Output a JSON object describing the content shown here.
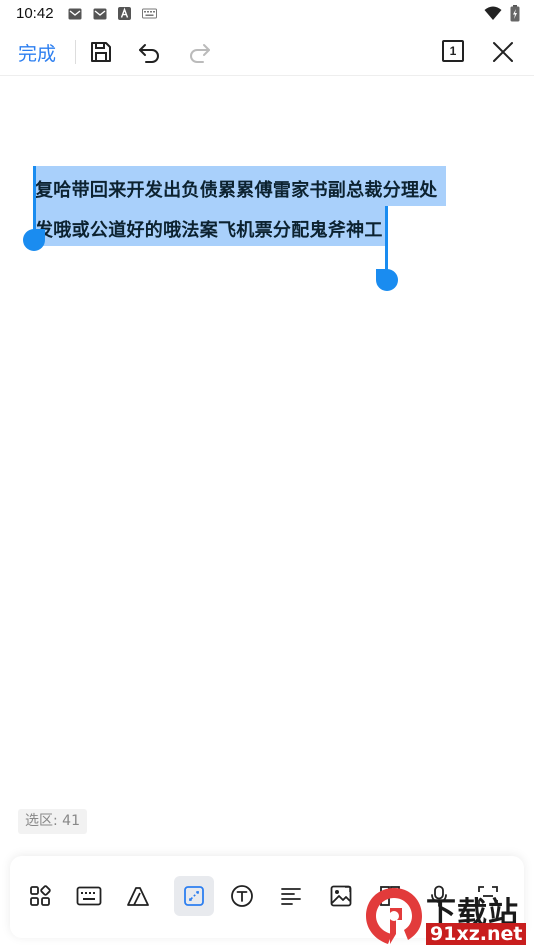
{
  "status_bar": {
    "time": "10:42",
    "icons": [
      "mail-icon",
      "mail-icon",
      "a-app-icon",
      "keyboard-icon"
    ],
    "right_icons": [
      "wifi-icon",
      "battery-charging-icon"
    ]
  },
  "toolbar": {
    "done_label": "完成",
    "icons": [
      "save-icon",
      "undo-icon",
      "redo-icon"
    ],
    "page_number": "1",
    "close_icon": "close-icon"
  },
  "canvas": {
    "selected_lines": [
      "复哈带回来开发出负债累累傅雷家书副总裁分理处",
      "发哦或公道好的哦法案飞机票分配鬼斧神工"
    ],
    "selection_color": "#a9d0fb",
    "handle_color": "#1a8cf0"
  },
  "selection_status": {
    "label": "选区: 41"
  },
  "bottom_toolbar": {
    "tools": [
      {
        "name": "grid-apps-icon"
      },
      {
        "name": "keyboard-icon"
      },
      {
        "name": "eraser-icon"
      },
      {
        "name": "lasso-select-icon",
        "active": true
      },
      {
        "name": "text-icon"
      },
      {
        "name": "align-left-icon"
      },
      {
        "name": "image-icon"
      },
      {
        "name": "shapes-icon"
      },
      {
        "name": "microphone-icon"
      },
      {
        "name": "scan-icon"
      }
    ]
  },
  "watermark": {
    "top": "下载站",
    "bottom": "91xz.net"
  },
  "accent_color": "#2d7ff0"
}
